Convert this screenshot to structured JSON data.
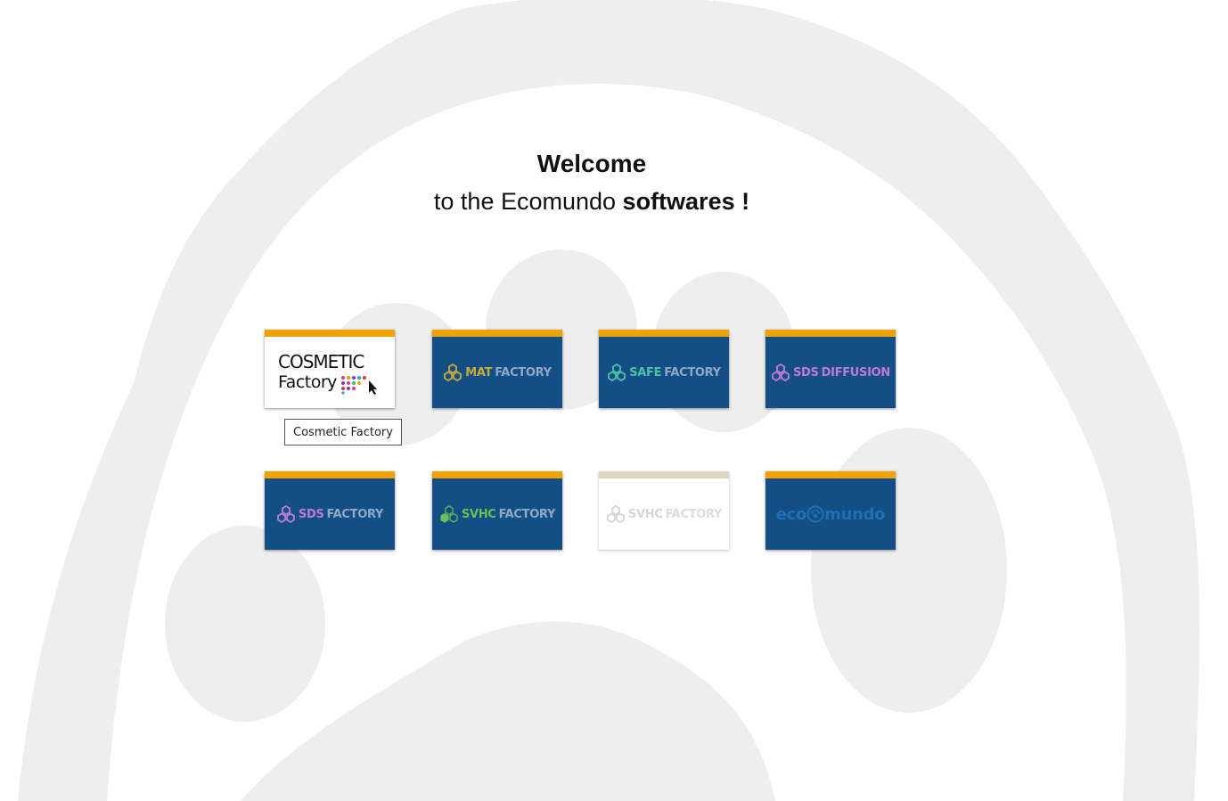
{
  "heading": {
    "line1": "Welcome",
    "line2_prefix": "to the Ecomundo ",
    "line2_emphasis": "softwares !"
  },
  "colors": {
    "tile_background": "#134f84",
    "tile_accent": "#f2a200",
    "disabled_accent": "#ddd6c3",
    "background_shape": "#eeeeee"
  },
  "tiles": [
    {
      "logo_line1": "COSMETIC",
      "logo_line2": "Factory",
      "icon": "cursor-dots-icon"
    },
    {
      "word_a": "MAT",
      "word_b": "FACTORY",
      "accent": "#c9a93a",
      "icon": "hexagon-cluster-icon"
    },
    {
      "word_a": "SAFE",
      "word_b": "FACTORY",
      "accent": "#4fc0a8",
      "icon": "hexagon-cluster-icon"
    },
    {
      "word_a": "SDS",
      "word_b": "DIFFUSION",
      "accent": "#c07ad6",
      "icon": "hexagon-cluster-icon"
    },
    {
      "word_a": "SDS",
      "word_b": "FACTORY",
      "accent": "#c07ad6",
      "icon": "hexagon-cluster-icon"
    },
    {
      "word_a": "SVHC",
      "word_b": "FACTORY",
      "accent": "#6cbf5a",
      "icon": "hexagon-cluster-icon"
    },
    {
      "word_a": "SVHC",
      "word_b": "FACTORY",
      "accent": "#d8d8d8",
      "icon": "hexagon-cluster-icon",
      "disabled": true
    },
    {
      "word_a": "eco",
      "word_b": "mundo",
      "accent": "#1f6fb2",
      "icon": "paw-globe-icon"
    }
  ],
  "tooltip": {
    "text": "Cosmetic Factory"
  }
}
